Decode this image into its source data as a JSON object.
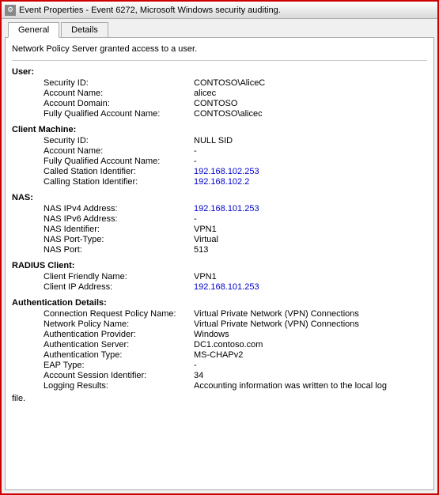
{
  "window": {
    "title": "Event Properties - Event 6272, Microsoft Windows security auditing.",
    "tabs": [
      {
        "label": "General",
        "active": true
      },
      {
        "label": "Details",
        "active": false
      }
    ]
  },
  "content": {
    "intro": "Network Policy Server granted access to a user.",
    "sections": [
      {
        "header": "User:",
        "properties": [
          {
            "label": "Security ID:",
            "value": "CONTOSO\\AliceC",
            "blue": false
          },
          {
            "label": "Account Name:",
            "value": "alicec",
            "blue": false
          },
          {
            "label": "Account Domain:",
            "value": "CONTOSO",
            "blue": false
          },
          {
            "label": "Fully Qualified Account Name:",
            "value": "CONTOSO\\alicec",
            "blue": false
          }
        ]
      },
      {
        "header": "Client Machine:",
        "properties": [
          {
            "label": "Security ID:",
            "value": "NULL SID",
            "blue": false
          },
          {
            "label": "Account Name:",
            "value": "-",
            "blue": false
          },
          {
            "label": "Fully Qualified Account Name:",
            "value": "-",
            "blue": false
          },
          {
            "label": "Called Station Identifier:",
            "value": "192.168.102.253",
            "blue": true
          },
          {
            "label": "Calling Station Identifier:",
            "value": "192.168.102.2",
            "blue": true
          }
        ]
      },
      {
        "header": "NAS:",
        "properties": [
          {
            "label": "NAS IPv4 Address:",
            "value": "192.168.101.253",
            "blue": true
          },
          {
            "label": "NAS IPv6 Address:",
            "value": "-",
            "blue": false
          },
          {
            "label": "NAS Identifier:",
            "value": "VPN1",
            "blue": false
          },
          {
            "label": "NAS Port-Type:",
            "value": "Virtual",
            "blue": false
          },
          {
            "label": "NAS Port:",
            "value": "513",
            "blue": false
          }
        ]
      },
      {
        "header": "RADIUS Client:",
        "properties": [
          {
            "label": "Client Friendly Name:",
            "value": "VPN1",
            "blue": false
          },
          {
            "label": "Client IP Address:",
            "value": "192.168.101.253",
            "blue": true
          }
        ]
      },
      {
        "header": "Authentication Details:",
        "properties": [
          {
            "label": "Connection Request Policy Name:",
            "value": "Virtual Private Network (VPN) Connections",
            "blue": false
          },
          {
            "label": "Network Policy Name:",
            "value": "Virtual Private Network (VPN) Connections",
            "blue": false
          },
          {
            "label": "Authentication Provider:",
            "value": "Windows",
            "blue": false
          },
          {
            "label": "Authentication Server:",
            "value": "DC1.contoso.com",
            "blue": false
          },
          {
            "label": "Authentication Type:",
            "value": "MS-CHAPv2",
            "blue": false
          },
          {
            "label": "EAP Type:",
            "value": "-",
            "blue": false
          },
          {
            "label": "Account Session Identifier:",
            "value": "34",
            "blue": false
          },
          {
            "label": "Logging Results:",
            "value": "Accounting information was written to the local log",
            "blue": false
          }
        ]
      }
    ],
    "footer": "file."
  }
}
